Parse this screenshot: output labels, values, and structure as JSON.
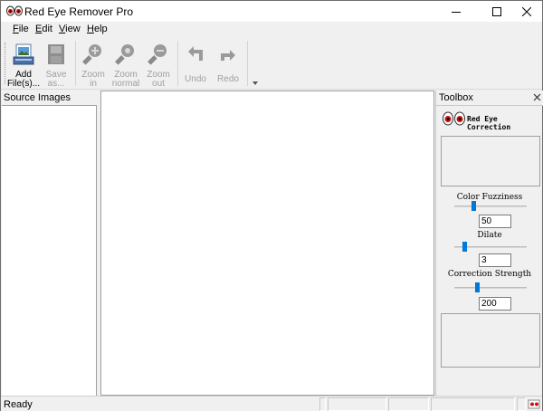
{
  "window": {
    "title": "Red Eye Remover Pro"
  },
  "menu": {
    "items": [
      {
        "label": "File",
        "accel": "F",
        "rest": "ile"
      },
      {
        "label": "Edit",
        "accel": "E",
        "rest": "dit"
      },
      {
        "label": "View",
        "accel": "V",
        "rest": "iew"
      },
      {
        "label": "Help",
        "accel": "H",
        "rest": "elp"
      }
    ]
  },
  "toolbar": {
    "add_files": "Add\nFile(s)...",
    "save_as": "Save\nas...",
    "zoom_in": "Zoom\nin",
    "zoom_normal": "Zoom\nnormal",
    "zoom_out": "Zoom\nout",
    "undo": "Undo",
    "redo": "Redo"
  },
  "source_panel": {
    "header": "Source Images"
  },
  "toolbox": {
    "header": "Toolbox",
    "title": "Red Eye\nCorrection",
    "color_fuzziness": {
      "label": "Color Fuzziness",
      "value": "50",
      "level": 0.25
    },
    "dilate": {
      "label": "Dilate",
      "value": "3",
      "level": 0.12
    },
    "correction_strength": {
      "label": "Correction Strength",
      "value": "200",
      "level": 0.3
    }
  },
  "status": {
    "text": "Ready"
  },
  "colors": {
    "accent": "#0078d7",
    "eye_red": "#cc1111"
  }
}
